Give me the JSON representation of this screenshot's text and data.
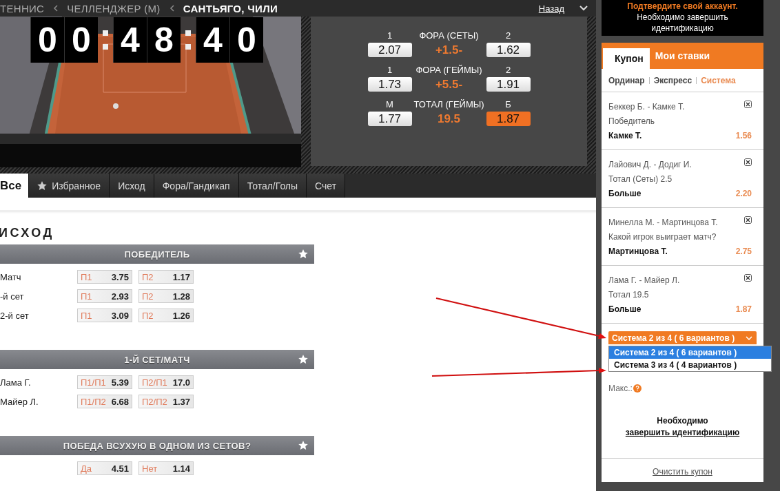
{
  "breadcrumb": {
    "items": [
      {
        "label": "ТЕННИС",
        "current": false
      },
      {
        "label": "ЧЕЛЛЕНДЖЕР (М)",
        "current": false
      },
      {
        "label": "САНТЬЯГО, ЧИЛИ",
        "current": true
      }
    ],
    "back": "Назад"
  },
  "timer": {
    "groups": [
      [
        "0",
        "0"
      ],
      [
        "4",
        "8"
      ],
      [
        "4",
        "0"
      ]
    ]
  },
  "live_markets": [
    {
      "left_label": "1",
      "title": "ФОРА (СЕТЫ)",
      "right_label": "2",
      "left": {
        "value": "2.07",
        "selected": false
      },
      "line": "+1.5-",
      "right": {
        "value": "1.62",
        "selected": false
      }
    },
    {
      "left_label": "1",
      "title": "ФОРА (ГЕЙМЫ)",
      "right_label": "2",
      "left": {
        "value": "1.73",
        "selected": false
      },
      "line": "+5.5-",
      "right": {
        "value": "1.91",
        "selected": false
      }
    },
    {
      "left_label": "М",
      "title": "ТОТАЛ (ГЕЙМЫ)",
      "right_label": "Б",
      "left": {
        "value": "1.77",
        "selected": false
      },
      "line": "19.5",
      "right": {
        "value": "1.87",
        "selected": true
      }
    }
  ],
  "tabs": [
    {
      "label": "Все",
      "kind": "plain",
      "selected": true
    },
    {
      "label": "Избранное",
      "kind": "starred",
      "selected": false
    },
    {
      "label": "Исход",
      "kind": "plain",
      "selected": false
    },
    {
      "label": "Фора/Гандикап",
      "kind": "plain",
      "selected": false
    },
    {
      "label": "Тотал/Голы",
      "kind": "plain",
      "selected": false
    },
    {
      "label": "Счет",
      "kind": "plain",
      "selected": false
    }
  ],
  "heading": "ИСХОД",
  "sections": [
    {
      "title": "ПОБЕДИТЕЛЬ",
      "rows": [
        {
          "label": "Матч",
          "odds": [
            {
              "label": "П1",
              "value": "3.75"
            },
            {
              "label": "П2",
              "value": "1.17"
            }
          ]
        },
        {
          "label": "-й сет",
          "odds": [
            {
              "label": "П1",
              "value": "2.93"
            },
            {
              "label": "П2",
              "value": "1.28"
            }
          ]
        },
        {
          "label": "2-й сет",
          "odds": [
            {
              "label": "П1",
              "value": "3.09"
            },
            {
              "label": "П2",
              "value": "1.26"
            }
          ]
        }
      ]
    },
    {
      "title": "1-Й СЕТ/МАТЧ",
      "rows": [
        {
          "label": "Лама Г.",
          "odds": [
            {
              "label": "П1/П1",
              "value": "5.39"
            },
            {
              "label": "П2/П1",
              "value": "17.0"
            }
          ]
        },
        {
          "label": "Майер Л.",
          "odds": [
            {
              "label": "П1/П2",
              "value": "6.68"
            },
            {
              "label": "П2/П2",
              "value": "1.37"
            }
          ]
        }
      ]
    },
    {
      "title": "ПОБЕДА ВСУХУЮ В ОДНОМ ИЗ СЕТОВ?",
      "rows": [
        {
          "odds": [
            {
              "label": "Да",
              "value": "4.51"
            },
            {
              "label": "Нет",
              "value": "1.14"
            }
          ]
        }
      ]
    }
  ],
  "alert": {
    "title": "Подтвердите свой аккаунт.",
    "text": "Необходимо завершить идентификацию"
  },
  "coupon": {
    "tabs": [
      {
        "label": "Купон",
        "selected": true
      },
      {
        "label": "Мои ставки",
        "selected": false
      }
    ],
    "modes": [
      {
        "label": "Ординар",
        "selected": false
      },
      {
        "label": "Экспресс",
        "selected": false
      },
      {
        "label": "Система",
        "selected": true
      }
    ],
    "bets": [
      {
        "match": "Беккер Б. - Камке Т.",
        "market": "Победитель",
        "pick": "Камке Т.",
        "odd": "1.56"
      },
      {
        "match": "Лайович Д. - Додиг И.",
        "market": "Тотал (Сеты) 2.5",
        "pick": "Больше",
        "odd": "2.20"
      },
      {
        "match": "Минелла М. - Мартинцова Т.",
        "market": "Какой игрок выиграет матч?",
        "pick": "Мартинцова Т.",
        "odd": "2.75"
      },
      {
        "match": "Лама Г. - Майер Л.",
        "market": "Тотал 19.5",
        "pick": "Больше",
        "odd": "1.87"
      }
    ],
    "system_select": {
      "value": "Система 2 из 4 ( 6 вариантов )",
      "expanded": true,
      "options": [
        {
          "label": "Система 2 из 4 ( 6 вариантов )",
          "selected": true
        },
        {
          "label": "Система 3 из 4 ( 4 вариантов )",
          "selected": false
        }
      ]
    },
    "max_label": "Макс.:",
    "notice": {
      "text": "Необходимо",
      "link": "завершить идентификацию"
    },
    "clear": "Очистить купон"
  }
}
